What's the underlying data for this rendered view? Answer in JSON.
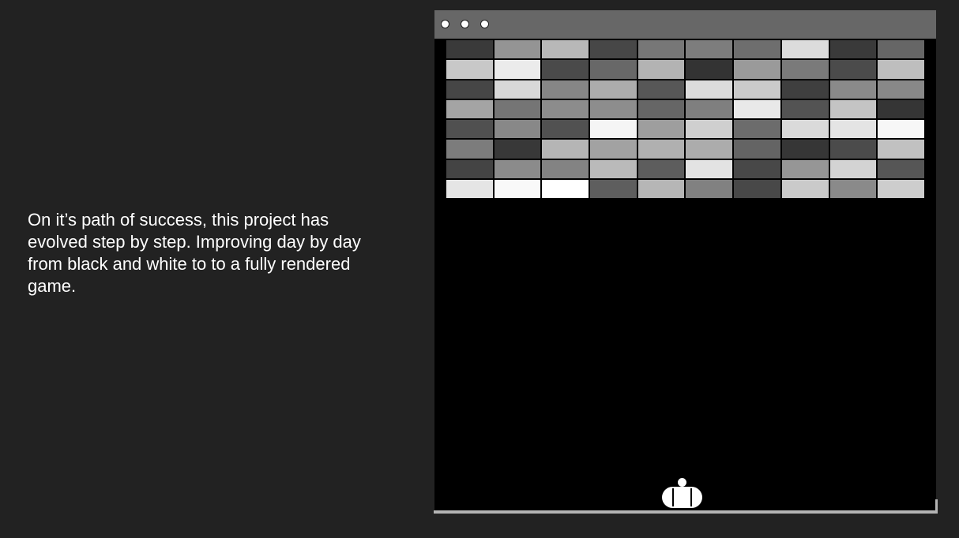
{
  "caption": {
    "text": "On it’s path of success, this project has evolved step by step. Improving day by day from black and white to to a fully rendered game."
  },
  "window": {
    "titlebar_color": "#676767",
    "controls": [
      "window-control-dot",
      "window-control-dot",
      "window-control-dot"
    ]
  },
  "game": {
    "background": "#000000",
    "brick_rows": [
      [
        "#3a3a3a",
        "#949494",
        "#b8b8b8",
        "#474747",
        "#777777",
        "#7d7d7d",
        "#6e6e6e",
        "#dcdcdc",
        "#3a3a3a",
        "#666666"
      ],
      [
        "#c8c8c8",
        "#ebebeb",
        "#4a4a4a",
        "#686868",
        "#b3b3b3",
        "#333333",
        "#9a9a9a",
        "#7a7a7a",
        "#4b4b4b",
        "#bebebe"
      ],
      [
        "#464646",
        "#d8d8d8",
        "#868686",
        "#acacac",
        "#575757",
        "#dcdcdc",
        "#cacaca",
        "#3f3f3f",
        "#8a8a8a",
        "#888888"
      ],
      [
        "#a4a4a4",
        "#757575",
        "#8c8c8c",
        "#8d8d8d",
        "#666666",
        "#7f7f7f",
        "#e9e9e9",
        "#535353",
        "#c4c4c4",
        "#353535"
      ],
      [
        "#505050",
        "#888888",
        "#515151",
        "#f5f5f5",
        "#9e9e9e",
        "#cfcfcf",
        "#6c6c6c",
        "#dadada",
        "#e4e4e4",
        "#f7f7f7"
      ],
      [
        "#7c7c7c",
        "#383838",
        "#b5b5b5",
        "#a2a2a2",
        "#b0b0b0",
        "#acacac",
        "#646464",
        "#363636",
        "#4b4b4b",
        "#c1c1c1"
      ],
      [
        "#444444",
        "#8b8b8b",
        "#838383",
        "#bababa",
        "#5d5d5d",
        "#e3e3e3",
        "#484848",
        "#969696",
        "#d3d3d3",
        "#565656"
      ],
      [
        "#e5e5e5",
        "#f9f9f9",
        "#ffffff",
        "#5e5e5e",
        "#b6b6b6",
        "#818181",
        "#484848",
        "#cacaca",
        "#8a8a8a",
        "#cdcdcd"
      ]
    ],
    "paddle_icon": "paddle-capsule",
    "ball_icon": "ball-circle"
  }
}
